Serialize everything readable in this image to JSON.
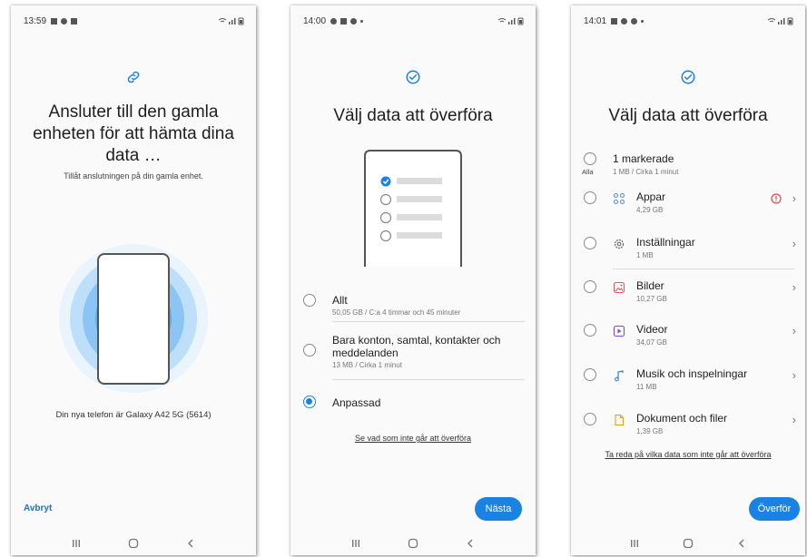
{
  "screen1": {
    "status_time": "13:59",
    "title": "Ansluter till den gamla enheten för att hämta dina data …",
    "subtitle": "Tillåt anslutningen på din gamla enhet.",
    "device_info": "Din nya telefon är Galaxy A42 5G (5614)",
    "cancel_label": "Avbryt"
  },
  "screen2": {
    "status_time": "14:00",
    "title": "Välj data att överföra",
    "options": [
      {
        "label": "Allt",
        "sub": "50,05 GB / C:a 4 timmar och 45 minuter",
        "selected": false
      },
      {
        "label": "Bara konton, samtal, kontakter och meddelanden",
        "sub": "13 MB / Cirka 1 minut",
        "selected": false
      },
      {
        "label": "Anpassad",
        "sub": "",
        "selected": true
      }
    ],
    "link": "Se vad som inte går att överföra",
    "next_label": "Nästa"
  },
  "screen3": {
    "status_time": "14:01",
    "title": "Välj data att överföra",
    "all_label": "Alla",
    "selected_count": "1 markerade",
    "selected_sub": "1 MB / Cirka 1 minut",
    "categories": [
      {
        "label": "Appar",
        "sub": "4,29 GB",
        "icon": "apps-icon",
        "warning": true
      },
      {
        "label": "Inställningar",
        "sub": "1 MB",
        "icon": "settings-icon",
        "warning": false
      },
      {
        "label": "Bilder",
        "sub": "10,27 GB",
        "icon": "image-icon",
        "warning": false
      },
      {
        "label": "Videor",
        "sub": "34,07 GB",
        "icon": "video-icon",
        "warning": false
      },
      {
        "label": "Musik och inspelningar",
        "sub": "11 MB",
        "icon": "music-icon",
        "warning": false
      },
      {
        "label": "Dokument och filer",
        "sub": "1,39 GB",
        "icon": "document-icon",
        "warning": false
      }
    ],
    "link": "Ta reda på vilka data som inte går att överföra",
    "transfer_label": "Överför"
  },
  "colors": {
    "accent": "#1a82e2",
    "ring_light": "#d6e9fb",
    "ring_mid": "#a8d2f7",
    "ring_dark": "#6db2ee",
    "warning": "#e04a4a"
  }
}
